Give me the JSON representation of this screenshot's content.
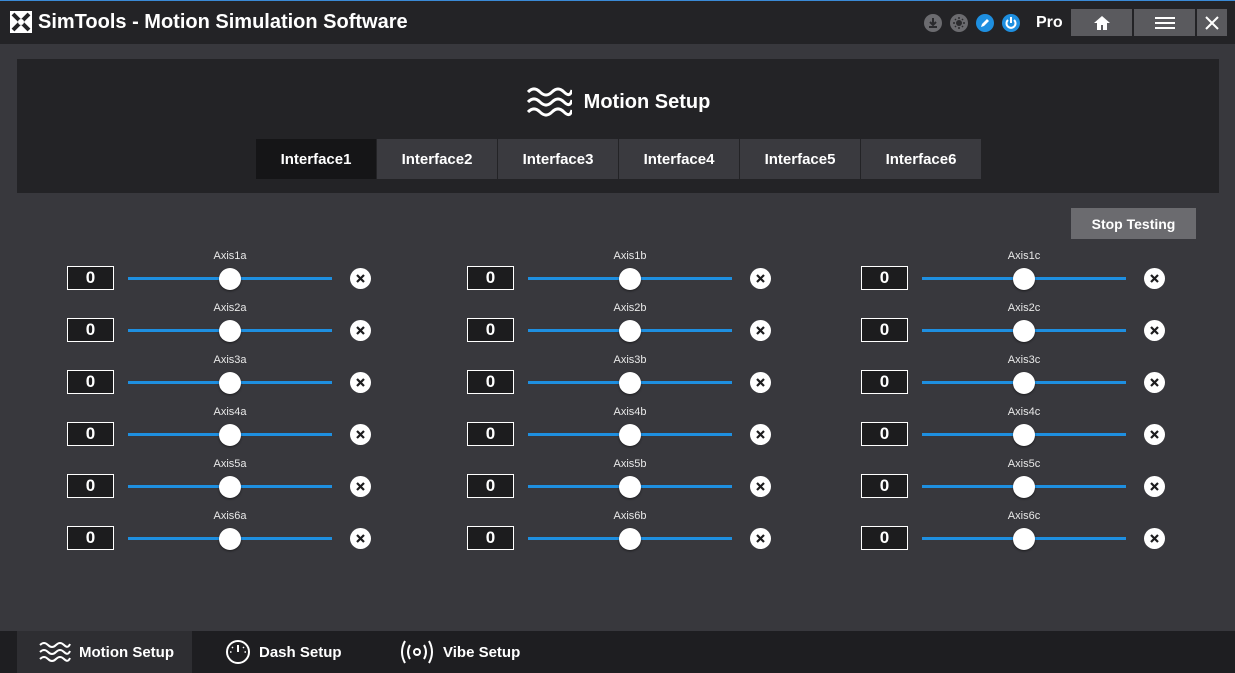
{
  "window": {
    "brand": "SimTools",
    "title_rest": " - Motion Simulation Software",
    "edition": "Pro"
  },
  "title_icons": [
    {
      "name": "download-icon",
      "color": "#6b6b6f"
    },
    {
      "name": "settings-sun-icon",
      "color": "#6b6b6f"
    },
    {
      "name": "pencil-icon",
      "color": "#1e8fe0"
    },
    {
      "name": "power-icon",
      "color": "#1e8fe0"
    }
  ],
  "header": {
    "heading": "Motion Setup",
    "tabs": [
      "Interface1",
      "Interface2",
      "Interface3",
      "Interface4",
      "Interface5",
      "Interface6"
    ],
    "active_tab": "Interface1"
  },
  "stop_testing_label": "Stop Testing",
  "axes": {
    "col_a": [
      {
        "label": "Axis1a",
        "value": "0"
      },
      {
        "label": "Axis2a",
        "value": "0"
      },
      {
        "label": "Axis3a",
        "value": "0"
      },
      {
        "label": "Axis4a",
        "value": "0"
      },
      {
        "label": "Axis5a",
        "value": "0"
      },
      {
        "label": "Axis6a",
        "value": "0"
      }
    ],
    "col_b": [
      {
        "label": "Axis1b",
        "value": "0"
      },
      {
        "label": "Axis2b",
        "value": "0"
      },
      {
        "label": "Axis3b",
        "value": "0"
      },
      {
        "label": "Axis4b",
        "value": "0"
      },
      {
        "label": "Axis5b",
        "value": "0"
      },
      {
        "label": "Axis6b",
        "value": "0"
      }
    ],
    "col_c": [
      {
        "label": "Axis1c",
        "value": "0"
      },
      {
        "label": "Axis2c",
        "value": "0"
      },
      {
        "label": "Axis3c",
        "value": "0"
      },
      {
        "label": "Axis4c",
        "value": "0"
      },
      {
        "label": "Axis5c",
        "value": "0"
      },
      {
        "label": "Axis6c",
        "value": "0"
      }
    ]
  },
  "slider_level": 0.5,
  "bottom_nav": [
    {
      "label": "Motion Setup",
      "icon": "waves-icon",
      "active": true
    },
    {
      "label": "Dash Setup",
      "icon": "gauge-icon",
      "active": false
    },
    {
      "label": "Vibe Setup",
      "icon": "vibration-icon",
      "active": false
    }
  ],
  "colors": {
    "accent": "#1e8fe0",
    "background": "#38383d",
    "panel": "#232326"
  }
}
